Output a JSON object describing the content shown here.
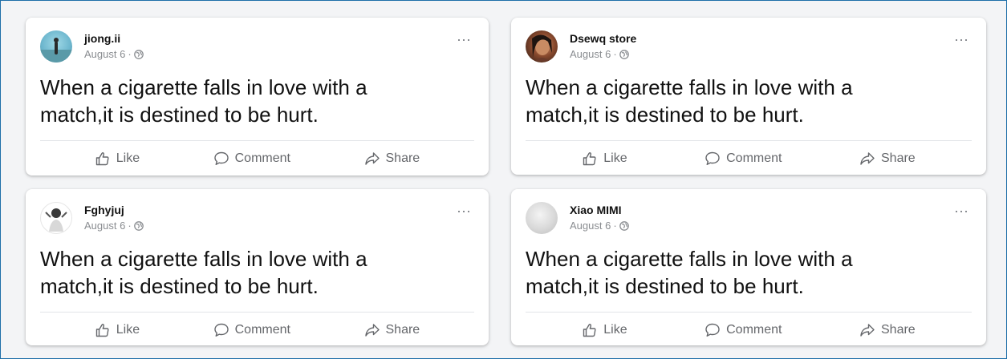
{
  "posts": [
    {
      "author": "jiong.ii",
      "date": "August 6",
      "separator": "·",
      "text": "When a cigarette falls in love with a match,it is destined to be hurt.",
      "more": "···",
      "like_label": "Like",
      "comment_label": "Comment",
      "share_label": "Share"
    },
    {
      "author": "Dsewq store",
      "date": "August 6",
      "separator": "·",
      "text": "When a cigarette falls in love with a match,it is destined to be hurt.",
      "more": "···",
      "like_label": "Like",
      "comment_label": "Comment",
      "share_label": "Share"
    },
    {
      "author": "Fghyjuj",
      "date": "August 6",
      "separator": "·",
      "text": "When a cigarette falls in love with a match,it is destined to be hurt.",
      "more": "···",
      "like_label": "Like",
      "comment_label": "Comment",
      "share_label": "Share"
    },
    {
      "author": "Xiao MIMI",
      "date": "August 6",
      "separator": "·",
      "text": "When a cigarette falls in love with a match,it is destined to be hurt.",
      "more": "···",
      "like_label": "Like",
      "comment_label": "Comment",
      "share_label": "Share"
    }
  ],
  "icons": {
    "like": "thumbs-up-icon",
    "comment": "comment-icon",
    "share": "share-icon",
    "privacy": "globe-icon",
    "more": "more-options-icon"
  },
  "colors": {
    "frame_border": "#1e6fa8",
    "action_text": "#65676b",
    "meta_text": "#8a8d91"
  }
}
